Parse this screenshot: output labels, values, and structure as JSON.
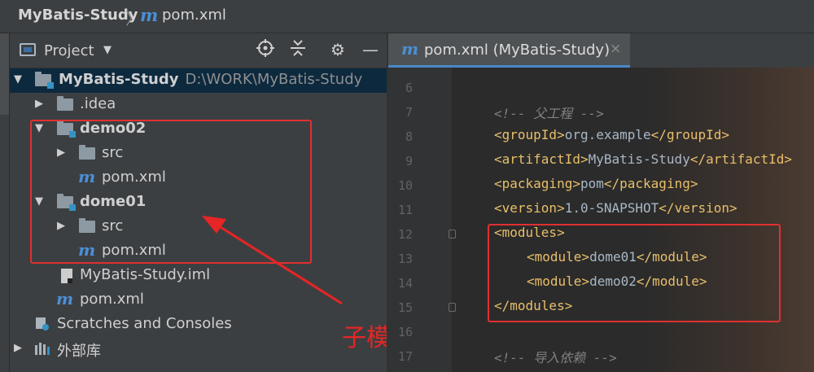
{
  "breadcrumb": {
    "project": "MyBatis-Study",
    "file_icon": "m",
    "file": "pom.xml"
  },
  "project_panel": {
    "title": "Project",
    "header_icons": [
      "target-icon",
      "collapse-icon",
      "gear-icon",
      "minimize-icon"
    ]
  },
  "tree": {
    "root": {
      "name": "MyBatis-Study",
      "path": "D:\\WORK\\MyBatis-Study"
    },
    "idea": ".idea",
    "demo02": {
      "name": "demo02",
      "src": "src",
      "pom": "pom.xml",
      "pom_icon": "m"
    },
    "dome01": {
      "name": "dome01",
      "src": "src",
      "pom": "pom.xml",
      "pom_icon": "m"
    },
    "iml": "MyBatis-Study.iml",
    "pom": "pom.xml",
    "pom_icon": "m",
    "scratches": "Scratches and Consoles",
    "external": "外部库"
  },
  "annotation": "子模块",
  "editor": {
    "tab_icon": "m",
    "tab_label": "pom.xml (MyBatis-Study)",
    "tab_close": "×",
    "line_numbers": [
      "6",
      "7",
      "8",
      "9",
      "10",
      "11",
      "12",
      "13",
      "14",
      "15",
      "16",
      "17"
    ],
    "lines": {
      "comment_parent": "<!-- 父工程 -->",
      "groupId": "org.example",
      "artifactId": "MyBatis-Study",
      "packaging": "pom",
      "version": "1.0-SNAPSHOT",
      "module1": "dome01",
      "module2": "demo02",
      "comment_deps": "<!-- 导入依赖 -->"
    },
    "tags": {
      "groupId_open": "<groupId>",
      "groupId_close": "</groupId>",
      "artifactId_open": "<artifactId>",
      "artifactId_close": "</artifactId>",
      "packaging_open": "<packaging>",
      "packaging_close": "</packaging>",
      "version_open": "<version>",
      "version_close": "</version>",
      "modules_open": "<modules>",
      "modules_close": "</modules>",
      "module_open": "<module>",
      "module_close": "</module>"
    }
  },
  "colors": {
    "tag": "#e8bf6a",
    "comment": "#808080",
    "text": "#a9b7c6",
    "annotation": "#e62525",
    "selection": "#0d293e"
  }
}
